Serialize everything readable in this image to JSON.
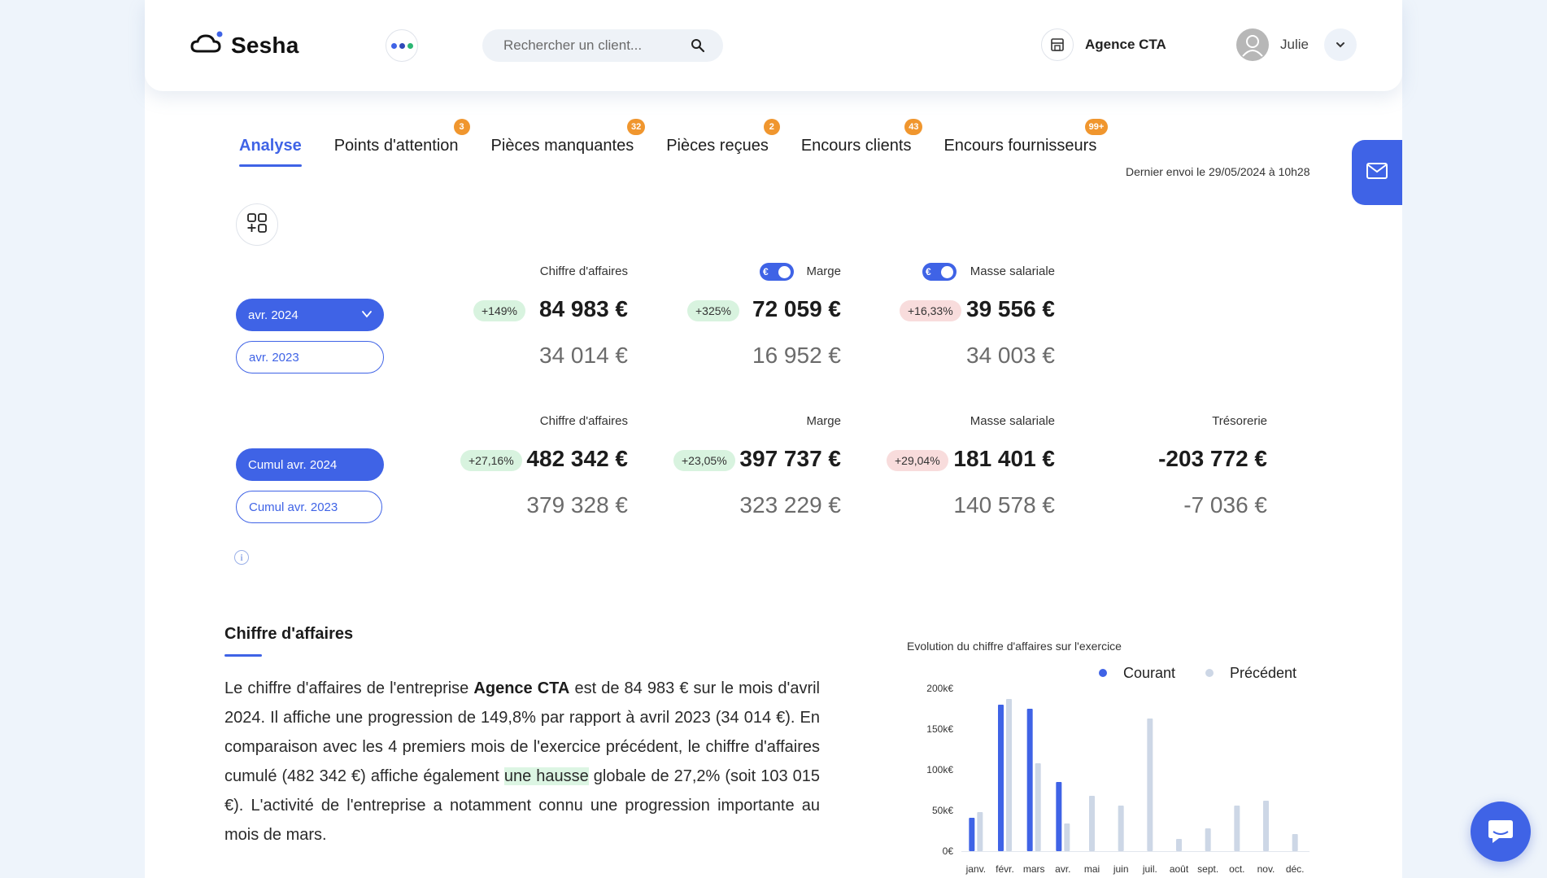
{
  "header": {
    "logo_text": "Sesha",
    "search_placeholder": "Rechercher un client...",
    "agency": "Agence CTA",
    "user": "Julie"
  },
  "tabs": [
    {
      "label": "Analyse",
      "badge": ""
    },
    {
      "label": "Points d'attention",
      "badge": "3"
    },
    {
      "label": "Pièces manquantes",
      "badge": "32"
    },
    {
      "label": "Pièces reçues",
      "badge": "2"
    },
    {
      "label": "Encours clients",
      "badge": "43"
    },
    {
      "label": "Encours fournisseurs",
      "badge": "99+"
    }
  ],
  "last_sent": "Dernier envoi le 29/05/2024 à 10h28",
  "colors": {
    "accent": "#3f63e6",
    "badge": "#f0962e",
    "up": "#d8f3df",
    "down": "#f8dcdc",
    "previous_bar": "#cdd7e6"
  },
  "monthly": {
    "current_period": "avr. 2024",
    "previous_period": "avr. 2023",
    "toggle_symbol": "€",
    "kpis": [
      {
        "label": "Chiffre d'affaires",
        "pct": "+149%",
        "trend": "up",
        "current": "84 983 €",
        "previous": "34 014 €"
      },
      {
        "label": "Marge",
        "pct": "+325%",
        "trend": "up",
        "current": "72 059 €",
        "previous": "16 952 €"
      },
      {
        "label": "Masse salariale",
        "pct": "+16,33%",
        "trend": "down",
        "current": "39 556 €",
        "previous": "34 003 €"
      }
    ]
  },
  "cumulative": {
    "current_period": "Cumul avr. 2024",
    "previous_period": "Cumul avr. 2023",
    "kpis": [
      {
        "label": "Chiffre d'affaires",
        "pct": "+27,16%",
        "trend": "up",
        "current": "482 342 €",
        "previous": "379 328 €"
      },
      {
        "label": "Marge",
        "pct": "+23,05%",
        "trend": "up",
        "current": "397 737 €",
        "previous": "323 229 €"
      },
      {
        "label": "Masse salariale",
        "pct": "+29,04%",
        "trend": "down",
        "current": "181 401 €",
        "previous": "140 578 €"
      },
      {
        "label": "Trésorerie",
        "pct": "",
        "trend": "",
        "current": "-203 772 €",
        "previous": "-7 036 €"
      }
    ]
  },
  "info_symbol": "i",
  "section": {
    "title": "Chiffre d'affaires",
    "text_1": "Le chiffre d'affaires de l'entreprise ",
    "company": "Agence CTA",
    "text_2": " est de 84 983 € sur le mois d'avril 2024. Il affiche une progression de 149,8% par rapport à avril 2023 (34 014 €). En comparaison avec les 4 premiers mois de l'exercice précédent, le chiffre d'affaires cumulé (482 342 €) affiche également ",
    "highlight": "une hausse",
    "text_3": " globale de 27,2% (soit 103 015 €). L'activité de l'entreprise a notamment connu une progression importante au mois de mars."
  },
  "chart_data": {
    "type": "bar",
    "title": "Evolution du chiffre d'affaires sur l'exercice",
    "categories": [
      "janv.",
      "févr.",
      "mars",
      "avr.",
      "mai",
      "juin",
      "juil.",
      "août",
      "sept.",
      "oct.",
      "nov.",
      "déc."
    ],
    "series": [
      {
        "name": "Courant",
        "color": "#3f63e6",
        "values": [
          41000,
          180000,
          175000,
          84983,
          null,
          null,
          null,
          null,
          null,
          null,
          null,
          null
        ]
      },
      {
        "name": "Précédent",
        "color": "#cdd7e6",
        "values": [
          48000,
          187000,
          108000,
          34014,
          68000,
          56000,
          163000,
          15000,
          28000,
          56000,
          62000,
          21000
        ]
      }
    ],
    "ylim": [
      0,
      200000
    ],
    "yticks": [
      0,
      50000,
      100000,
      150000,
      200000
    ],
    "ytick_labels": [
      "0€",
      "50k€",
      "100k€",
      "150k€",
      "200k€"
    ],
    "legend": "top-right",
    "grid": false
  }
}
